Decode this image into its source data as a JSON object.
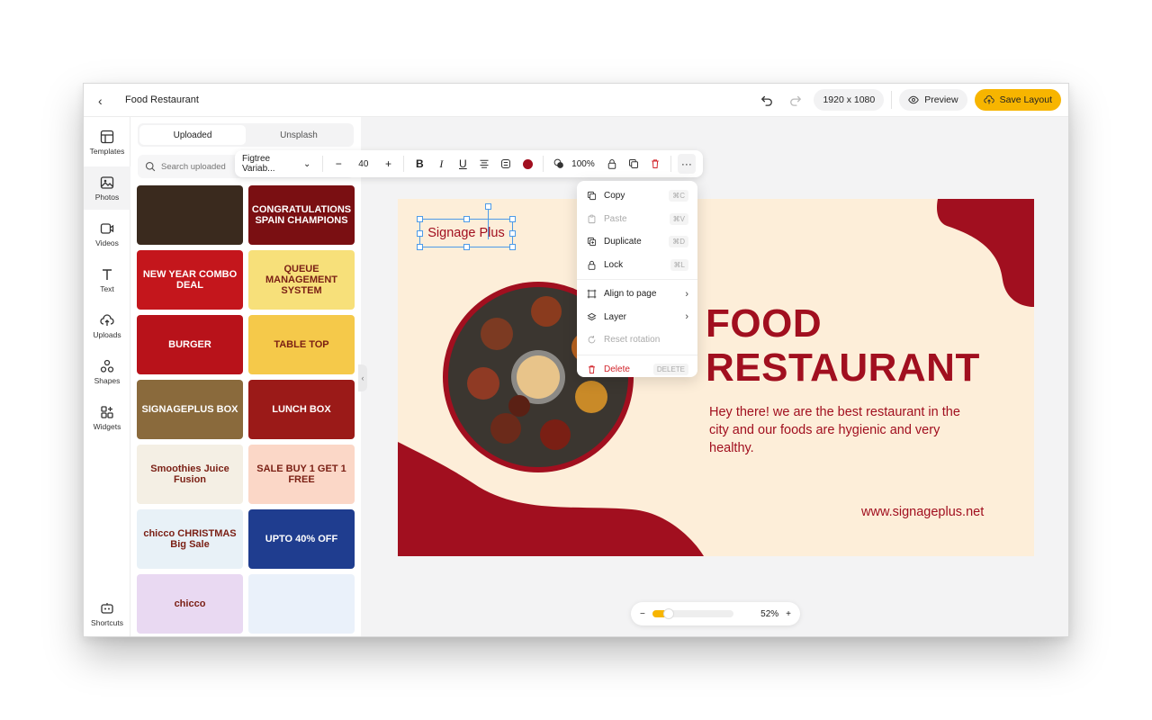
{
  "topbar": {
    "title": "Food Restaurant",
    "canvas_size": "1920 x 1080",
    "preview_label": "Preview",
    "save_label": "Save Layout"
  },
  "rail": {
    "items": [
      {
        "label": "Templates",
        "icon": "templates-icon"
      },
      {
        "label": "Photos",
        "icon": "photos-icon"
      },
      {
        "label": "Videos",
        "icon": "videos-icon"
      },
      {
        "label": "Text",
        "icon": "text-icon"
      },
      {
        "label": "Uploads",
        "icon": "uploads-icon"
      },
      {
        "label": "Shapes",
        "icon": "shapes-icon"
      },
      {
        "label": "Widgets",
        "icon": "widgets-icon"
      }
    ],
    "shortcuts_label": "Shortcuts"
  },
  "panel": {
    "tabs": [
      "Uploaded",
      "Unsplash"
    ],
    "search_placeholder": "Search uploaded",
    "thumbs": [
      {
        "text": "",
        "bg": "#3a2a1e"
      },
      {
        "text": "CONGRATULATIONS SPAIN CHAMPIONS",
        "bg": "#7a0f12"
      },
      {
        "text": "NEW YEAR COMBO DEAL",
        "bg": "#c4161c"
      },
      {
        "text": "QUEUE MANAGEMENT SYSTEM",
        "bg": "#f7e07a"
      },
      {
        "text": "BURGER",
        "bg": "#b8121a"
      },
      {
        "text": "TABLE TOP",
        "bg": "#f5c94a"
      },
      {
        "text": "SIGNAGEPLUS BOX",
        "bg": "#8a6a3c"
      },
      {
        "text": "LUNCH BOX",
        "bg": "#9b1a18"
      },
      {
        "text": "Smoothies Juice Fusion",
        "bg": "#f4efe4"
      },
      {
        "text": "SALE BUY 1 GET 1 FREE",
        "bg": "#fbd7c7"
      },
      {
        "text": "chicco CHRISTMAS Big Sale",
        "bg": "#e8f1f7"
      },
      {
        "text": "UPTO 40% OFF",
        "bg": "#1f3d8f"
      },
      {
        "text": "chicco",
        "bg": "#e9d9f2"
      },
      {
        "text": "",
        "bg": "#eaf1fa"
      }
    ]
  },
  "toolbar": {
    "font_name": "Figtree Variab...",
    "font_size": "40",
    "opacity": "100%",
    "text_color": "#a10f1f"
  },
  "canvas": {
    "selected_text": "Signage Plus",
    "title_line1": "FOOD",
    "title_line2": "RESTAURANT",
    "description": "Hey there! we are the best restaurant in the city and our foods are hygienic and very healthy.",
    "website": "www.signageplus.net",
    "bg_color": "#fdeed9",
    "accent_color": "#a10f1f"
  },
  "context_menu": {
    "items": [
      {
        "label": "Copy",
        "shortcut": "⌘C",
        "disabled": false
      },
      {
        "label": "Paste",
        "shortcut": "⌘V",
        "disabled": true
      },
      {
        "label": "Duplicate",
        "shortcut": "⌘D",
        "disabled": false
      },
      {
        "label": "Lock",
        "shortcut": "⌘L",
        "disabled": false
      },
      {
        "label": "Align to page"
      },
      {
        "label": "Layer"
      },
      {
        "label": "Reset rotation",
        "disabled": true
      },
      {
        "label": "Delete",
        "shortcut": "DELETE"
      }
    ]
  },
  "zoom": {
    "value": "52%",
    "level": 0.14
  }
}
